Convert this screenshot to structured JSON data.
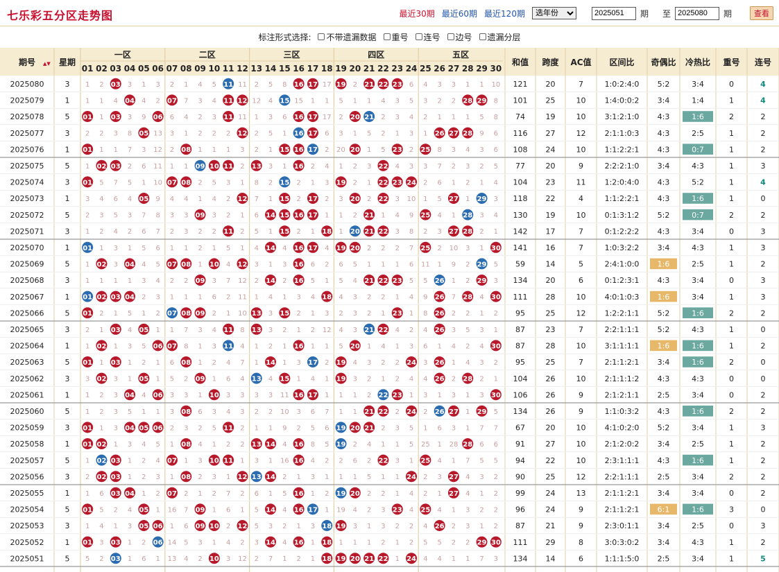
{
  "app_title": "七乐彩五分区走势图",
  "nav": {
    "links": [
      "最近30期",
      "最近60期",
      "最近120期"
    ],
    "active": 0,
    "year_select": "选年份",
    "start": "2025051",
    "end": "2025080",
    "period": "期",
    "to": "至",
    "button": "查看"
  },
  "options": {
    "label": "标注形式选择:",
    "items": [
      "不带遗漏数据",
      "重号",
      "连号",
      "边号",
      "遗漏分层"
    ]
  },
  "table": {
    "h_period": "期号",
    "sort_icon": "▲▼",
    "h_week": "星期",
    "zones": [
      "一区",
      "二区",
      "三区",
      "四区",
      "五区"
    ],
    "numbers": [
      "01",
      "02",
      "03",
      "04",
      "05",
      "06",
      "07",
      "08",
      "09",
      "10",
      "11",
      "12",
      "13",
      "14",
      "15",
      "16",
      "17",
      "18",
      "19",
      "20",
      "21",
      "22",
      "23",
      "24",
      "25",
      "26",
      "27",
      "28",
      "29",
      "30"
    ],
    "h_stats": [
      "和值",
      "跨度",
      "AC值",
      "区间比",
      "奇偶比",
      "冷热比",
      "重号",
      "连号"
    ],
    "rows": [
      [
        "2025080",
        3,
        "1 2 5 3 1 3 2 1 4 5 1 11 2 5 8 1 16 17 19 2 21 22 23 6 4 3 3 1 1 10",
        "S:3,16,17,19,21,22,23|B:11",
        "121",
        "20",
        "7",
        "1:0:2:4:0",
        "5:2",
        "3:4",
        "0",
        "4"
      ],
      [
        "2025079",
        1,
        "1 1 4 1 4 2 1 7 3 4 10 11 12 4 7 15 1 1 5 1 1 4 3 5 3 2 2 28 29 8",
        "S:4,7,11,12,28,29|B:15",
        "101",
        "25",
        "10",
        "1:4:0:0:2",
        "3:4",
        "1:4",
        "1",
        "4"
      ],
      [
        "2025078",
        5,
        "1 1 3 3 9 1 6 4 2 3 3 11 1 3 6 2 16 17 2 20 21 2 3 4 2 1 1 1 5 8",
        "S:1,3,6,11,16,17,20|B:21",
        "74",
        "19",
        "10",
        "3:1:2:1:0",
        "4:3",
        "1:6",
        "2",
        "2"
      ],
      [
        "2025077",
        3,
        "2 2 3 8 5 13 3 1 2 2 2 12 2 5 1 16 17 6 3 1 5 2 1 3 1 26 27 28 9 6",
        "S:5,12,17,26,27,28|B:16",
        "116",
        "27",
        "12",
        "2:1:1:0:3",
        "4:3",
        "2:5",
        "1",
        "2"
      ],
      [
        "2025076",
        1,
        "1 1 1 7 3 12 2 8 1 1 1 3 2 1 15 16 17 2 20 1 1 5 23 2 25 8 3 4 3 6",
        "S:1,8,15,16,20,23,25|B:17",
        "108",
        "24",
        "10",
        "1:1:2:2:1",
        "4:3",
        "0:7",
        "1",
        "2"
      ],
      [
        "2025075",
        5,
        "1 2 3 2 6 11 1 1 9 10 11 2 13 3 1 16 2 4 1 2 3 22 4 3 3 7 2 3 2 5",
        "S:2,3,10,11,13,16,22|B:9",
        "77",
        "20",
        "9",
        "2:2:2:1:0",
        "3:4",
        "4:3",
        "1",
        "3"
      ],
      [
        "2025074",
        3,
        "1 5 7 5 1 10 7 8 2 5 3 1 8 2 15 2 1 3 19 2 1 22 23 24 2 6 1 2 1 4",
        "S:1,7,8,19,22,23,24|B:15",
        "104",
        "23",
        "11",
        "1:2:0:4:0",
        "4:3",
        "5:2",
        "1",
        "4"
      ],
      [
        "2025073",
        1,
        "3 4 6 4 5 9 4 4 1 4 2 12 7 1 15 2 17 2 3 20 2 22 3 10 1 5 27 1 29 3",
        "S:5,12,15,17,20,22,27|B:29",
        "118",
        "22",
        "4",
        "1:1:2:2:1",
        "4:3",
        "1:6",
        "1",
        "0"
      ],
      [
        "2025072",
        5,
        "2 3 5 3 7 8 3 3 9 3 2 1 6 14 15 16 17 1 1 2 21 1 4 9 25 4 1 28 3 4",
        "S:9,14,15,16,17,21,25|B:28",
        "130",
        "19",
        "10",
        "0:1:3:1:2",
        "5:2",
        "0:7",
        "2",
        "2"
      ],
      [
        "2025071",
        3,
        "1 2 4 2 6 7 2 3 2 2 11 2 5 1 15 2 1 18 1 20 21 22 3 8 2 3 27 28 2 1",
        "S:11,15,18,21,22,27,28|B:20",
        "142",
        "17",
        "7",
        "0:1:2:2:2",
        "4:3",
        "3:4",
        "0",
        "3"
      ],
      [
        "2025070",
        1,
        "1 1 3 1 5 6 1 1 2 1 5 1 4 14 4 16 17 4 19 20 2 2 2 7 25 2 10 3 1 30",
        "S:14,16,17,19,20,25,30|B:1",
        "141",
        "16",
        "7",
        "1:0:3:2:2",
        "3:4",
        "4:3",
        "1",
        "3"
      ],
      [
        "2025069",
        5,
        "1 2 3 4 4 5 7 8 1 10 4 12 3 1 3 16 6 2 6 5 1 1 1 6 11 1 9 2 29 5",
        "S:2,4,7,8,10,12,16|B:29",
        "59",
        "14",
        "5",
        "2:4:1:0:0",
        "1:6",
        "2:5",
        "1",
        "2"
      ],
      [
        "2025068",
        3,
        "1 1 1 1 3 4 2 2 9 3 7 12 2 14 2 16 5 1 5 4 21 22 23 5 5 26 1 2 29 3",
        "S:9,14,16,21,22,23,29|B:26",
        "134",
        "20",
        "6",
        "0:1:2:3:1",
        "4:3",
        "3:4",
        "0",
        "3"
      ],
      [
        "2025067",
        1,
        "1 2 3 4 2 3 1 1 1 6 2 11 1 4 1 3 4 18 4 3 2 2 1 4 9 26 7 28 4 30",
        "S:2,3,4,18,26,28,30|B:1",
        "111",
        "28",
        "10",
        "4:0:1:0:3",
        "1:6",
        "3:4",
        "1",
        "3"
      ],
      [
        "2025066",
        5,
        "1 2 1 5 1 2 7 8 9 2 1 10 13 3 15 2 1 3 2 3 2 1 23 1 8 26 2 2 1 2",
        "S:1,8,9,13,15,23,26|B:7",
        "95",
        "25",
        "12",
        "1:2:2:1:1",
        "5:2",
        "1:6",
        "2",
        "2"
      ],
      [
        "2025065",
        3,
        "2 1 3 4 5 1 1 7 3 4 11 8 13 3 2 1 2 12 4 3 21 22 4 2 4 26 3 5 3 1",
        "S:3,5,11,13,22,26|B:21",
        "87",
        "23",
        "7",
        "2:2:1:1:1",
        "5:2",
        "4:3",
        "1",
        "0"
      ],
      [
        "2025064",
        1,
        "1 2 1 3 5 6 7 8 1 3 11 4 1 2 1 16 1 1 5 20 1 4 1 3 6 1 4 2 4 30",
        "S:2,6,7,16,20,30|B:11",
        "87",
        "28",
        "10",
        "3:1:1:1:1",
        "1:6",
        "1:6",
        "1",
        "2"
      ],
      [
        "2025063",
        5,
        "1 1 3 1 2 1 6 8 1 2 4 7 1 14 1 3 17 2 19 4 3 2 2 24 3 26 1 4 3 2",
        "S:1,3,8,14,19,24,26|B:17",
        "95",
        "25",
        "7",
        "2:1:1:2:1",
        "3:4",
        "1:6",
        "2",
        "0"
      ],
      [
        "2025062",
        3,
        "3 2 3 1 5 1 5 2 9 1 6 4 13 4 15 1 4 1 19 3 2 1 2 4 4 26 2 28 2 1",
        "S:2,5,9,15,19,26,28|B:13",
        "104",
        "26",
        "10",
        "2:1:1:1:2",
        "4:3",
        "4:3",
        "0",
        "0"
      ],
      [
        "2025061",
        1,
        "1 2 3 1 4 6 3 3 1 10 3 3 3 3 11 16 17 1 1 1 2 22 23 1 3 1 3 1 3 30",
        "S:4,6,10,16,17,23,30|B:22",
        "106",
        "26",
        "9",
        "2:1:2:1:1",
        "2:5",
        "3:4",
        "0",
        "2"
      ],
      [
        "2025060",
        5,
        "1 2 3 5 1 1 3 8 6 3 4 3 2 2 10 3 6 7 1 1 21 22 2 24 2 26 27 1 29 5",
        "S:8,21,22,24,27,29|B:26",
        "134",
        "26",
        "9",
        "1:1:0:3:2",
        "4:3",
        "1:6",
        "2",
        "2"
      ],
      [
        "2025059",
        3,
        "1 1 3 4 5 6 2 3 2 5 11 2 1 1 9 2 5 6 19 20 21 2 3 5 1 6 3 1 7 7",
        "S:1,4,5,6,11,20,21|B:19",
        "67",
        "20",
        "10",
        "4:1:0:2:0",
        "5:2",
        "3:4",
        "1",
        "3"
      ],
      [
        "2025058",
        1,
        "1 2 1 3 4 5 1 8 4 1 2 2 13 14 4 16 8 5 19 2 4 1 1 5 25 1 28 28 6 6",
        "S:1,2,8,13,14,16,28|B:19",
        "91",
        "27",
        "10",
        "2:1:2:0:2",
        "3:4",
        "2:5",
        "1",
        "2"
      ],
      [
        "2025057",
        5,
        "1 2 3 1 2 4 7 1 3 10 11 1 3 1 16 3 4 2 2 6 2 22 3 1 25 4 1 7 5 5",
        "S:3,7,10,11,16,22,25|B:2",
        "94",
        "22",
        "10",
        "2:3:1:1:1",
        "4:3",
        "1:6",
        "1",
        "2"
      ],
      [
        "2025056",
        3,
        "2 2 3 1 2 3 1 8 2 3 1 12 13 14 2 1 3 1 1 1 5 1 1 24 2 3 27 4 3 2",
        "S:2,3,8,12,14,24,27|B:13",
        "90",
        "25",
        "12",
        "2:2:1:1:1",
        "2:5",
        "3:4",
        "2",
        "2"
      ],
      [
        "2025055",
        1,
        "1 6 3 4 1 2 7 2 1 2 7 2 6 1 5 16 1 2 19 20 2 2 1 4 2 1 27 4 1 2",
        "S:3,4,7,16,20,27|B:19",
        "99",
        "24",
        "13",
        "2:1:1:2:1",
        "3:4",
        "3:4",
        "0",
        "2"
      ],
      [
        "2025054",
        5,
        "1 5 2 4 5 1 16 7 9 1 6 1 5 14 4 16 17 1 19 4 2 3 23 4 25 4 1 3 2 2",
        "S:1,5,9,14,16,23,25|B:17",
        "96",
        "24",
        "9",
        "2:1:1:2:1",
        "6:1",
        "1:6",
        "3",
        "0"
      ],
      [
        "2025053",
        3,
        "1 4 1 3 5 6 1 6 9 10 2 12 5 3 2 1 3 18 19 3 1 3 2 2 4 26 2 3 1 2",
        "S:5,6,9,10,12,19,26|B:18",
        "87",
        "21",
        "9",
        "2:3:0:1:1",
        "3:4",
        "2:5",
        "0",
        "3"
      ],
      [
        "2025052",
        1,
        "1 3 3 1 2 6 14 5 3 1 4 2 3 14 4 16 1 18 1 1 1 2 1 2 5 5 2 2 29 30",
        "S:1,3,14,16,18,29,30|B:6",
        "111",
        "29",
        "8",
        "3:0:3:0:2",
        "3:4",
        "4:3",
        "1",
        "2"
      ],
      [
        "2025051",
        5,
        "5 2 3 1 6 1 13 4 2 10 3 12 2 7 1 2 1 18 19 20 21 22 1 24 4 4 1 1 7 3",
        "S:10,18,19,20,21,22,24|B:3",
        "134",
        "14",
        "6",
        "1:1:1:5:0",
        "2:5",
        "3:4",
        "1",
        "5"
      ]
    ]
  },
  "colors": {
    "red": "#b8192a",
    "blue": "#2b6cb0",
    "header_bg": "#f6ecd2",
    "border": "#e2cfa5",
    "zone_tint": "#fbe9e6",
    "zone_tint2": "#e8eef8",
    "even_bg": "#ffffff",
    "hl_orange": "#e8b86a",
    "hl_teal": "#6aa8a0",
    "text_red": "#c8102e",
    "text_teal": "#128a80"
  }
}
